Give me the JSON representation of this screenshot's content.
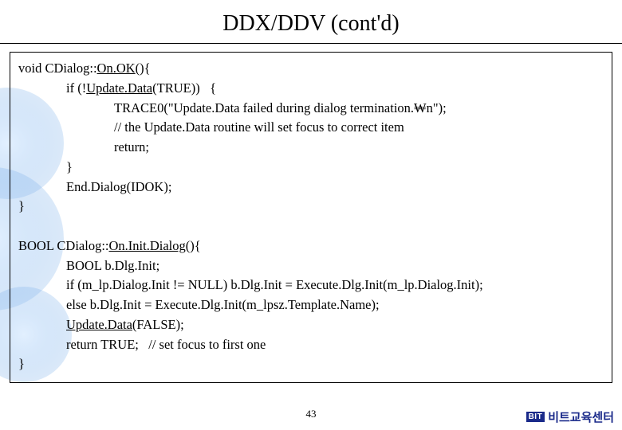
{
  "title": "DDX/DDV (cont'd)",
  "code": {
    "l1a": "void CDialog::",
    "l1b": "On.OK",
    "l1c": "(){",
    "l2a": "if (!",
    "l2b": "Update.Data",
    "l2c": "(TRUE))   {",
    "l3": "TRACE0(\"Update.Data failed during dialog termination.₩n\");",
    "l4": "// the Update.Data routine will set focus to correct item",
    "l5": "return;",
    "l6": "}",
    "l7": "End.Dialog(IDOK);",
    "l8": "}",
    "blank": " ",
    "l9a": "BOOL CDialog::",
    "l9b": "On.Init.Dialog",
    "l9c": "(){",
    "l10": "BOOL b.Dlg.Init;",
    "l11": "if (m_lp.Dialog.Init != NULL) b.Dlg.Init = Execute.Dlg.Init(m_lp.Dialog.Init);",
    "l12": "else b.Dlg.Init = Execute.Dlg.Init(m_lpsz.Template.Name);",
    "l13a": "Update.Data",
    "l13b": "(FALSE);",
    "l14": "return TRUE;   // set focus to first one",
    "l15": "}"
  },
  "page_number": "43",
  "brand_badge": "BIT",
  "brand_text": "비트교육센터"
}
